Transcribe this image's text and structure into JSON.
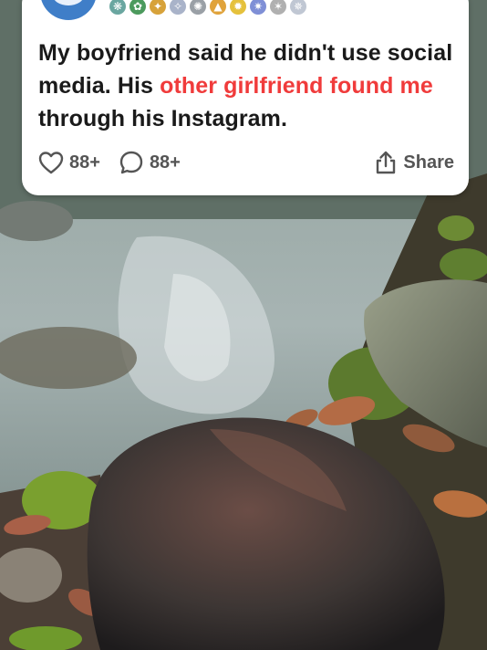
{
  "post": {
    "title_parts": [
      {
        "text": "My boyfriend said he didn't use social media. His ",
        "highlight": false
      },
      {
        "text": "other girlfriend found me",
        "highlight": true
      },
      {
        "text": " through his Instagram.",
        "highlight": false
      }
    ],
    "title_part0": "My boyfriend said he didn't use social media. His ",
    "title_part1": "other girlfriend found me",
    "title_part2": " through his Instagram.",
    "likes": "88+",
    "comments": "88+",
    "share_label": "Share",
    "badges": [
      {
        "icon": "award-icon",
        "glyph": "❋",
        "color": "#6aa6a0"
      },
      {
        "icon": "award-icon",
        "glyph": "✿",
        "color": "#4c9a5d"
      },
      {
        "icon": "award-icon",
        "glyph": "✦",
        "color": "#d7a23a"
      },
      {
        "icon": "award-icon",
        "glyph": "✧",
        "color": "#a9b3c9"
      },
      {
        "icon": "award-icon",
        "glyph": "✺",
        "color": "#9aa0a6"
      },
      {
        "icon": "award-icon",
        "glyph": "▲",
        "color": "#e0a33b"
      },
      {
        "icon": "award-icon",
        "glyph": "✹",
        "color": "#e5c13c"
      },
      {
        "icon": "award-icon",
        "glyph": "✷",
        "color": "#7f8fd6"
      },
      {
        "icon": "award-icon",
        "glyph": "✶",
        "color": "#b0b0b0"
      },
      {
        "icon": "award-icon",
        "glyph": "✵",
        "color": "#c0c7d3"
      }
    ]
  },
  "colors": {
    "highlight": "#f03b3b",
    "avatar": "#3f7ec8",
    "card": "#ffffff"
  }
}
